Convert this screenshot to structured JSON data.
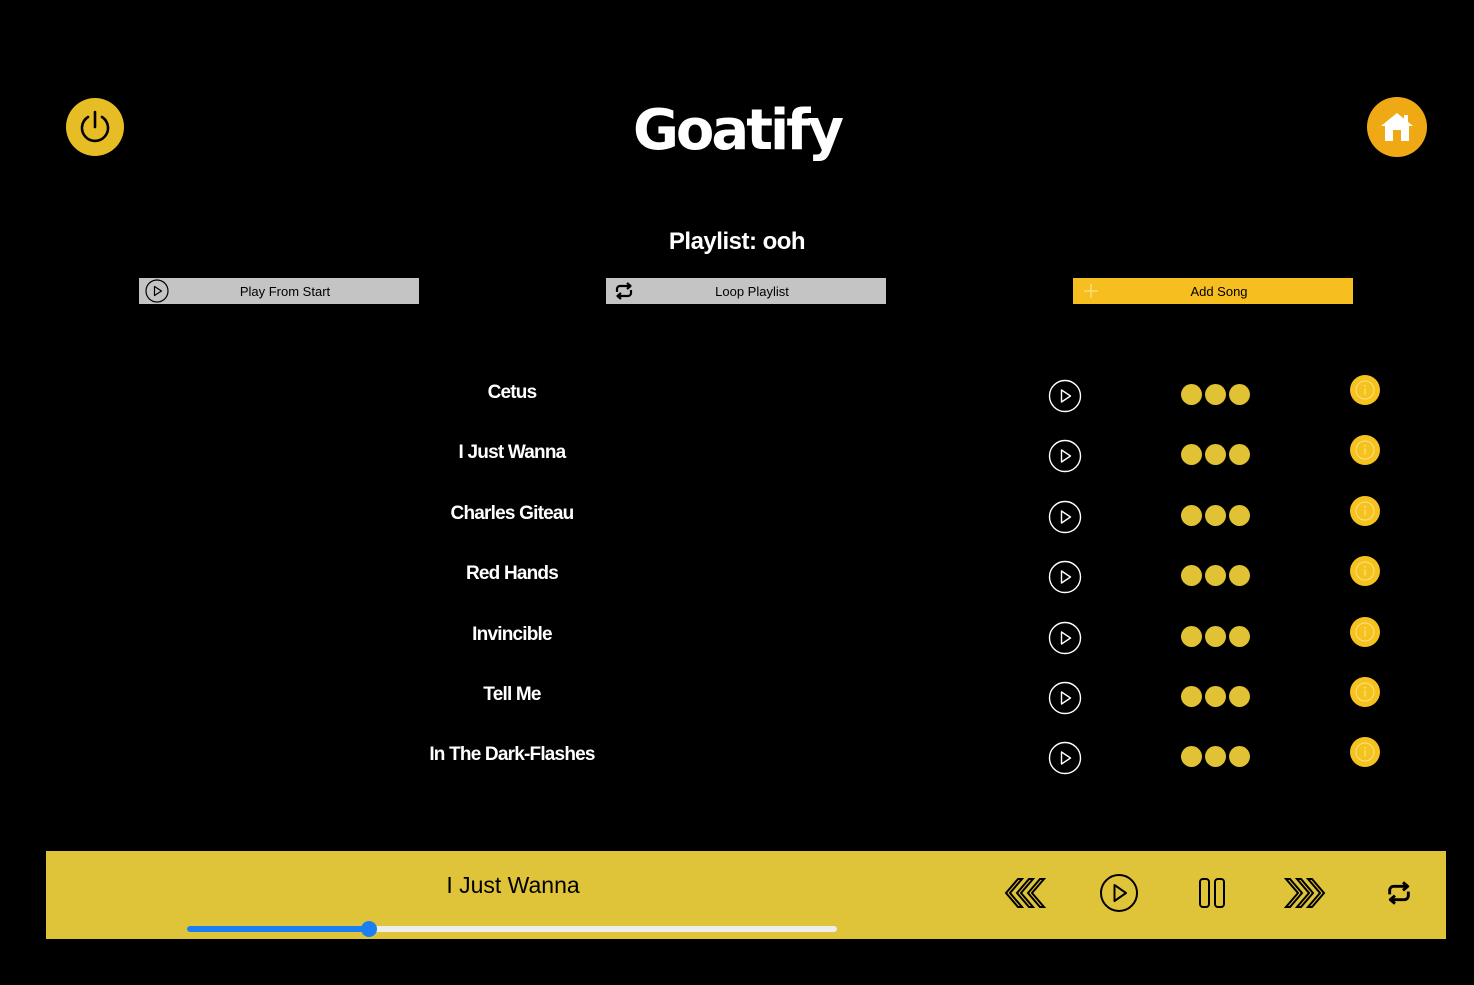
{
  "app": {
    "logo": "Goatify",
    "colors": {
      "background": "#000000",
      "accent": "#E7BD25",
      "player_bar": "#DFC43A",
      "progress": "#1A7EF5"
    }
  },
  "header": {
    "power_icon": "power-icon",
    "home_icon": "home-icon"
  },
  "playlist": {
    "title": "Playlist: ooh",
    "actions": [
      {
        "label": "Play From Start",
        "icon": "play-circle-icon"
      },
      {
        "label": "Loop Playlist",
        "icon": "repeat-icon"
      },
      {
        "label": "Add Song",
        "icon": "plus-icon"
      }
    ],
    "songs": [
      {
        "title": "Cetus"
      },
      {
        "title": "I Just Wanna"
      },
      {
        "title": "Charles Giteau"
      },
      {
        "title": "Red Hands"
      },
      {
        "title": "Invincible"
      },
      {
        "title": "Tell Me"
      },
      {
        "title": "In The Dark-Flashes"
      }
    ]
  },
  "player": {
    "now_playing": "I Just Wanna",
    "progress": 0.28,
    "controls": [
      "rewind-icon",
      "play-circle-icon",
      "pause-icon",
      "fast-forward-icon",
      "repeat-icon"
    ]
  }
}
